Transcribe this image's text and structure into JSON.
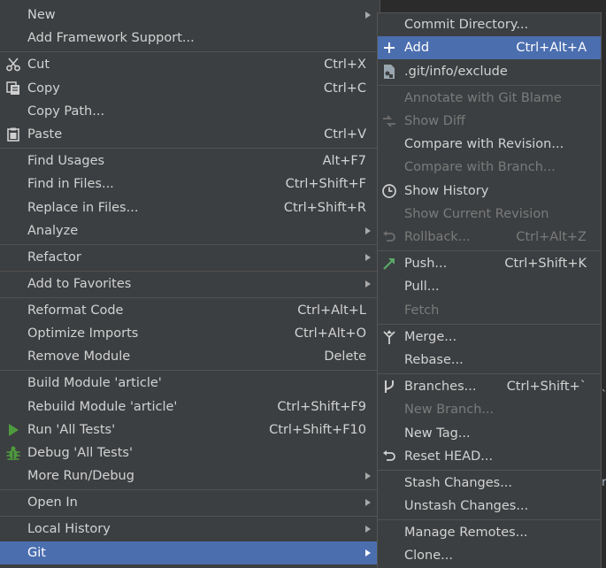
{
  "main_menu": {
    "items": [
      {
        "label": "New",
        "shortcut": "",
        "icon": "",
        "submenu": true
      },
      {
        "label": "Add Framework Support...",
        "shortcut": ""
      },
      {
        "label": "Cut",
        "shortcut": "Ctrl+X",
        "icon": "scissors-icon"
      },
      {
        "label": "Copy",
        "shortcut": "Ctrl+C",
        "icon": "copy-icon"
      },
      {
        "label": "Copy Path...",
        "shortcut": ""
      },
      {
        "label": "Paste",
        "shortcut": "Ctrl+V",
        "icon": "clipboard-icon"
      },
      {
        "label": "Find Usages",
        "shortcut": "Alt+F7"
      },
      {
        "label": "Find in Files...",
        "shortcut": "Ctrl+Shift+F"
      },
      {
        "label": "Replace in Files...",
        "shortcut": "Ctrl+Shift+R"
      },
      {
        "label": "Analyze",
        "shortcut": "",
        "submenu": true
      },
      {
        "label": "Refactor",
        "shortcut": "",
        "submenu": true
      },
      {
        "label": "Add to Favorites",
        "shortcut": "",
        "submenu": true
      },
      {
        "label": "Reformat Code",
        "shortcut": "Ctrl+Alt+L"
      },
      {
        "label": "Optimize Imports",
        "shortcut": "Ctrl+Alt+O"
      },
      {
        "label": "Remove Module",
        "shortcut": "Delete"
      },
      {
        "label": "Build Module 'article'",
        "shortcut": ""
      },
      {
        "label": "Rebuild Module 'article'",
        "shortcut": "Ctrl+Shift+F9"
      },
      {
        "label": "Run 'All Tests'",
        "shortcut": "Ctrl+Shift+F10",
        "icon": "run-icon"
      },
      {
        "label": "Debug 'All Tests'",
        "shortcut": "",
        "icon": "debug-icon"
      },
      {
        "label": "More Run/Debug",
        "shortcut": "",
        "submenu": true
      },
      {
        "label": "Open In",
        "shortcut": "",
        "submenu": true
      },
      {
        "label": "Local History",
        "shortcut": "",
        "submenu": true
      },
      {
        "label": "Git",
        "shortcut": "",
        "submenu": true,
        "selected": true
      }
    ]
  },
  "git_menu": {
    "items": [
      {
        "label": "Commit Directory...",
        "shortcut": ""
      },
      {
        "label": "Add",
        "shortcut": "Ctrl+Alt+A",
        "icon": "plus-icon",
        "selected": true
      },
      {
        "label": ".git/info/exclude",
        "shortcut": "",
        "icon": "file-icon"
      },
      {
        "label": "Annotate with Git Blame",
        "shortcut": "",
        "disabled": true
      },
      {
        "label": "Show Diff",
        "shortcut": "",
        "icon": "diff-icon",
        "disabled": true
      },
      {
        "label": "Compare with Revision...",
        "shortcut": ""
      },
      {
        "label": "Compare with Branch...",
        "shortcut": "",
        "disabled": true
      },
      {
        "label": "Show History",
        "shortcut": "",
        "icon": "clock-icon"
      },
      {
        "label": "Show Current Revision",
        "shortcut": "",
        "disabled": true
      },
      {
        "label": "Rollback...",
        "shortcut": "Ctrl+Alt+Z",
        "icon": "rollback-icon",
        "disabled": true
      },
      {
        "label": "Push...",
        "shortcut": "Ctrl+Shift+K",
        "icon": "push-arrow-icon"
      },
      {
        "label": "Pull...",
        "shortcut": ""
      },
      {
        "label": "Fetch",
        "shortcut": "",
        "disabled": true
      },
      {
        "label": "Merge...",
        "shortcut": "",
        "icon": "merge-icon"
      },
      {
        "label": "Rebase...",
        "shortcut": ""
      },
      {
        "label": "Branches...",
        "shortcut": "Ctrl+Shift+`",
        "icon": "branch-icon"
      },
      {
        "label": "New Branch...",
        "shortcut": "",
        "disabled": true
      },
      {
        "label": "New Tag...",
        "shortcut": ""
      },
      {
        "label": "Reset HEAD...",
        "shortcut": "",
        "icon": "reset-icon"
      },
      {
        "label": "Stash Changes...",
        "shortcut": ""
      },
      {
        "label": "Unstash Changes...",
        "shortcut": ""
      },
      {
        "label": "Manage Remotes...",
        "shortcut": ""
      },
      {
        "label": "Clone...",
        "shortcut": ""
      }
    ]
  },
  "colors": {
    "menu_bg": "#3c3f41",
    "selection": "#4b6eaf",
    "text": "#d2d2d2",
    "disabled_text": "#7a7a7a",
    "run_green": "#4e9a3e",
    "push_green": "#59a869"
  },
  "background_edge": {
    "glyphs": [
      "`",
      "r"
    ]
  }
}
